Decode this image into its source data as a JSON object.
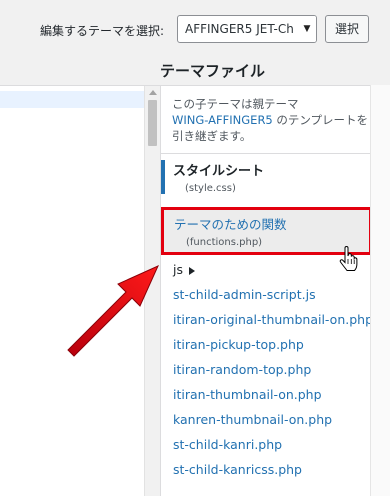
{
  "header": {
    "select_label": "編集するテーマを選択:",
    "selected_theme": "AFFINGER5 JET-Ch",
    "select_button": "選択"
  },
  "files": {
    "heading": "テーマファイル",
    "inherit_note_prefix": "この子テーマは親テーマ",
    "parent_theme": "WING-AFFINGER5",
    "inherit_note_suffix": "のテンプレートを引き継ぎます。",
    "items": [
      {
        "label": "スタイルシート",
        "filename": "(style.css)"
      },
      {
        "label": "テーマのための関数",
        "filename": "(functions.php)"
      }
    ],
    "folder": "js",
    "links": [
      "st-child-admin-script.js",
      "itiran-original-thumbnail-on.php",
      "itiran-pickup-top.php",
      "itiran-random-top.php",
      "itiran-thumbnail-on.php",
      "kanren-thumbnail-on.php",
      "st-child-kanri.php",
      "st-child-kanricss.php"
    ]
  },
  "colors": {
    "link": "#2271b1",
    "highlight_border": "#e3000f",
    "arrow": "#e60012"
  },
  "icons": {
    "dropdown": "chevron-down-icon",
    "folder_toggle": "triangle-right-icon",
    "pointer": "hand-pointer-icon",
    "annotation": "red-arrow-icon"
  }
}
